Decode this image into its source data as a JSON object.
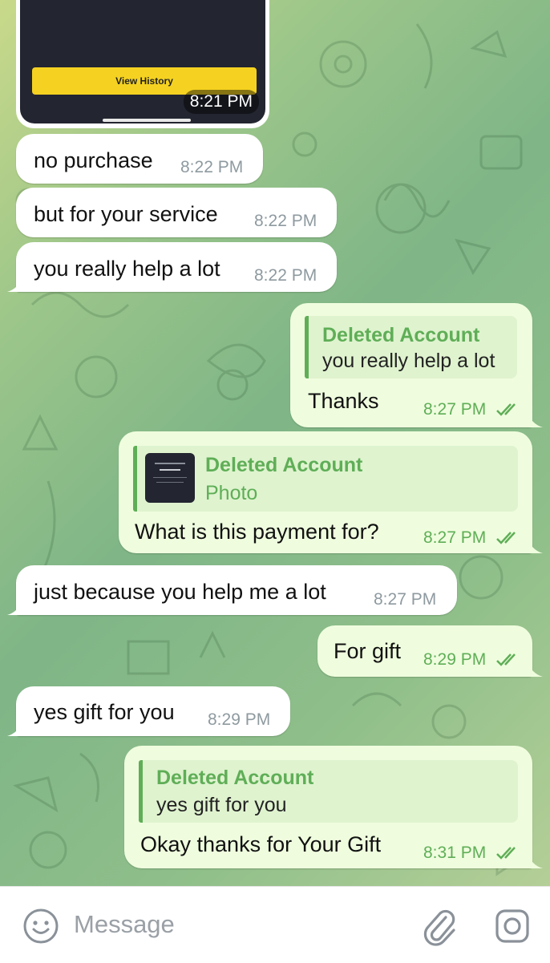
{
  "screenshot_card": {
    "button_label": "View History",
    "time": "8:21 PM"
  },
  "messages": [
    {
      "text": "no purchase",
      "time": "8:22 PM"
    },
    {
      "text": "but for your service",
      "time": "8:22 PM"
    },
    {
      "text": "you really help a lot",
      "time": "8:22 PM"
    },
    {
      "reply_author": "Deleted Account",
      "reply_text": "you really help a lot",
      "text": "Thanks",
      "time": "8:27 PM"
    },
    {
      "reply_author": "Deleted Account",
      "reply_text": "Photo",
      "text": "What is this payment for?",
      "time": "8:27 PM"
    },
    {
      "text": "just because you help me a lot",
      "time": "8:27 PM"
    },
    {
      "text": "For gift",
      "time": "8:29 PM"
    },
    {
      "text": "yes gift for you",
      "time": "8:29 PM"
    },
    {
      "reply_author": "Deleted Account",
      "reply_text": "yes gift for you",
      "text": "Okay thanks for Your Gift",
      "time": "8:31 PM"
    }
  ],
  "composer": {
    "placeholder": "Message",
    "emoji_icon": "emoji-icon",
    "attach_icon": "paperclip-icon",
    "camera_icon": "camera-icon"
  },
  "colors": {
    "outgoing_bubble": "#effdde",
    "incoming_bubble": "#ffffff",
    "accent_green": "#5fae57",
    "view_history_button": "#f5d221"
  }
}
